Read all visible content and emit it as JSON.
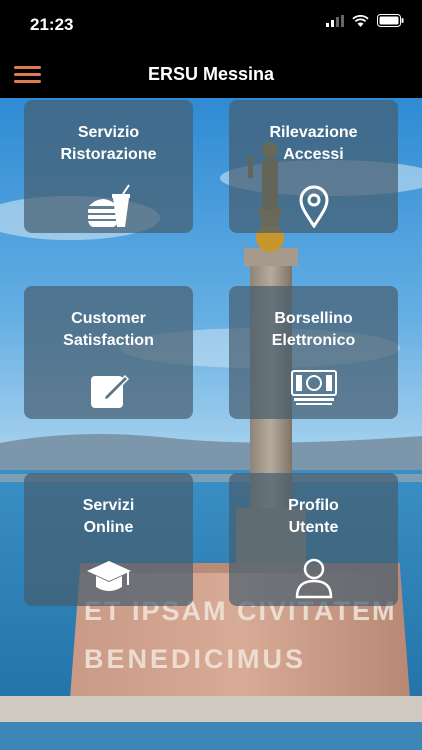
{
  "status_bar": {
    "time": "21:23",
    "icons": [
      "signal-icon",
      "wifi-icon",
      "battery-icon"
    ]
  },
  "header": {
    "title": "ERSU Messina",
    "menu_icon": "hamburger-menu-icon",
    "accent": "#e07a55"
  },
  "background": {
    "inscription_line1": "ET IPSAM CIVITATEM",
    "inscription_line2": "BENEDICIMUS"
  },
  "tiles": [
    {
      "line1": "Servizio",
      "line2": "Ristorazione",
      "icon": "fast-food-icon"
    },
    {
      "line1": "Rilevazione",
      "line2": "Accessi",
      "icon": "location-pin-icon"
    },
    {
      "line1": "Customer",
      "line2": "Satisfaction",
      "icon": "edit-note-icon"
    },
    {
      "line1": "Borsellino",
      "line2": "Elettronico",
      "icon": "banknote-icon"
    },
    {
      "line1": "Servizi",
      "line2": "Online",
      "icon": "graduation-cap-icon"
    },
    {
      "line1": "Profilo",
      "line2": "Utente",
      "icon": "user-profile-icon"
    }
  ]
}
